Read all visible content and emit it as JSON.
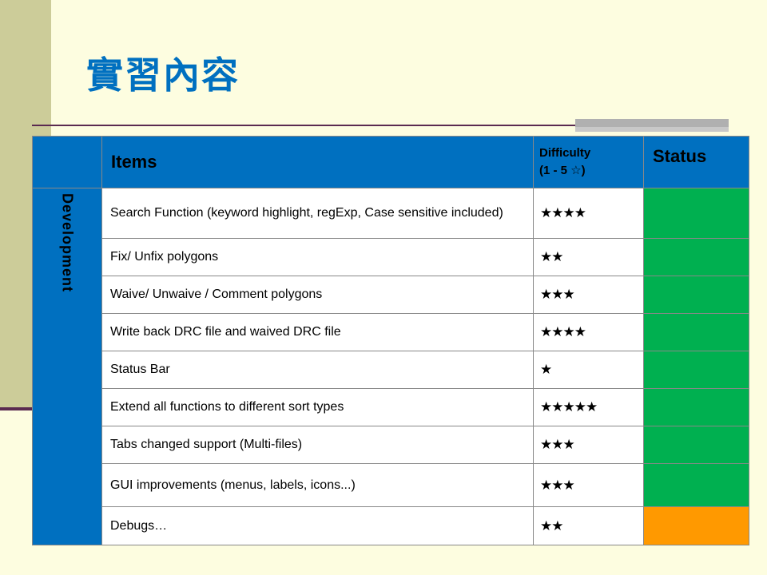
{
  "slide": {
    "title": "實習內容",
    "table": {
      "headers": {
        "items": "Items",
        "difficulty_line1": "Difficulty",
        "difficulty_line2": "(1 - 5 ☆)",
        "status": "Status"
      },
      "section_label": "Development",
      "rows": [
        {
          "item": "Search Function (keyword highlight, regExp, Case sensitive included)",
          "stars": "★★★★",
          "difficulty": 4,
          "status_color": "#00b050"
        },
        {
          "item": "Fix/ Unfix polygons",
          "stars": "★★",
          "difficulty": 2,
          "status_color": "#00b050"
        },
        {
          "item": "Waive/ Unwaive / Comment polygons",
          "stars": "★★★",
          "difficulty": 3,
          "status_color": "#00b050"
        },
        {
          "item": "Write back DRC file and waived DRC file",
          "stars": "★★★★",
          "difficulty": 4,
          "status_color": "#00b050"
        },
        {
          "item": "Status Bar",
          "stars": "★",
          "difficulty": 1,
          "status_color": "#00b050"
        },
        {
          "item": "Extend all functions to different sort types",
          "stars": "★★★★★",
          "difficulty": 5,
          "status_color": "#00b050"
        },
        {
          "item": "Tabs changed support (Multi-files)",
          "stars": "★★★",
          "difficulty": 3,
          "status_color": "#00b050"
        },
        {
          "item": "GUI improvements (menus, labels, icons...)",
          "stars": "★★★",
          "difficulty": 3,
          "status_color": "#00b050"
        },
        {
          "item": "Debugs…",
          "stars": "★★",
          "difficulty": 2,
          "status_color": "#ff9900"
        }
      ]
    }
  },
  "colors": {
    "accent_blue": "#0070c0",
    "done_green": "#00b050",
    "in_progress_orange": "#ff9900",
    "background": "#fdfde0"
  }
}
